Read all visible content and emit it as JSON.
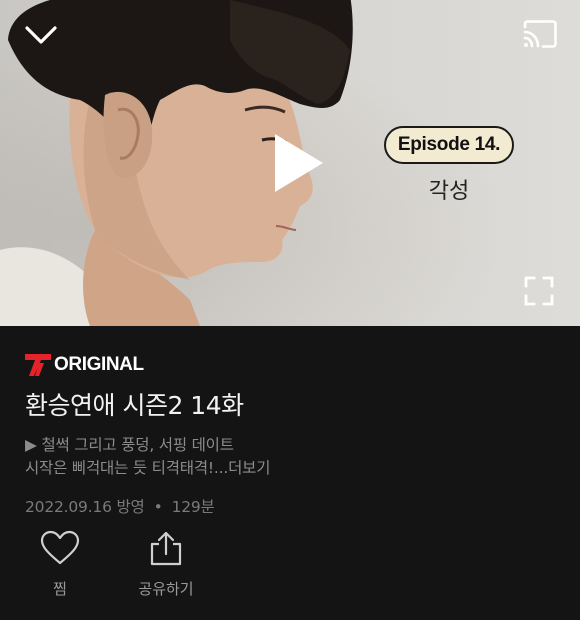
{
  "player": {
    "episode_badge": "Episode 14.",
    "episode_title": "각성",
    "icons": {
      "collapse": "chevron-down-icon",
      "cast": "cast-icon",
      "play": "play-icon",
      "fullscreen": "fullscreen-icon"
    }
  },
  "brand": {
    "logo_letter": "T",
    "label": "ORIGINAL",
    "accent_color": "#e6222b"
  },
  "show": {
    "title": "환승연애 시즌2 14화",
    "synopsis_line1": "▶ 철썩 그리고 풍덩, 서핑 데이트",
    "synopsis_line2": "시작은 삐걱대는 듯 티격태격!",
    "more_label": "...더보기",
    "air_date": "2022.09.16 방영",
    "separator": "•",
    "runtime": "129분"
  },
  "actions": {
    "like_label": "찜",
    "like_icon": "heart-icon",
    "share_label": "공유하기",
    "share_icon": "share-icon"
  }
}
